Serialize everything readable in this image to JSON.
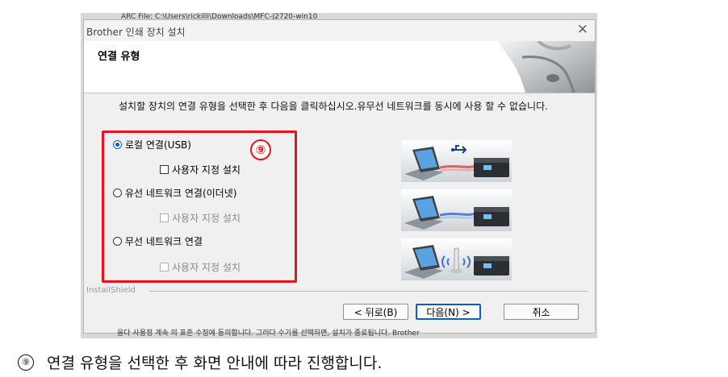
{
  "background_window": {
    "top_text": "ARC File:     C:\\Users\\rickilli\\Downloads\\MFC-J2720-win10",
    "bottom_text": "을다 사용정 계속 의 표준 수정에 동의합니다. 그러다 수기를 선택하면, 설치가 종료됩니다. Brother"
  },
  "dialog": {
    "title": "Brother 인쇄 장치 설치",
    "close_glyph": "✕",
    "header_title": "연결 유형",
    "instruction": "설치할 장치의 연결 유형을 선택한 후 다음을 클릭하십시오.유무선 네트워크를 동시에 사용 할 수 없습니다.",
    "options": [
      {
        "label": "로컬 연결(USB)",
        "selected": true,
        "custom_label": "사용자 지정 설치",
        "custom_enabled": true
      },
      {
        "label": "유선 네트워크 연결(이더넷)",
        "selected": false,
        "custom_label": "사용자 지정 설치",
        "custom_enabled": false
      },
      {
        "label": "무선 네트워크 연결",
        "selected": false,
        "custom_label": "사용자 지정 설치",
        "custom_enabled": false
      }
    ],
    "footer_brand": "InstallShield",
    "buttons": {
      "back": "< 뒤로(B)",
      "next": "다음(N) >",
      "cancel": "취소"
    }
  },
  "annotation": {
    "badge": "⑨",
    "caption_num": "⑨",
    "caption_text": "연결 유형을 선택한 후 화면 안내에 따라 진행합니다.",
    "highlight_color": "#e8141b"
  },
  "colors": {
    "accent": "#0a5fc4",
    "usb_cable": "#e04040",
    "lan_cable": "#3a6fd8"
  }
}
